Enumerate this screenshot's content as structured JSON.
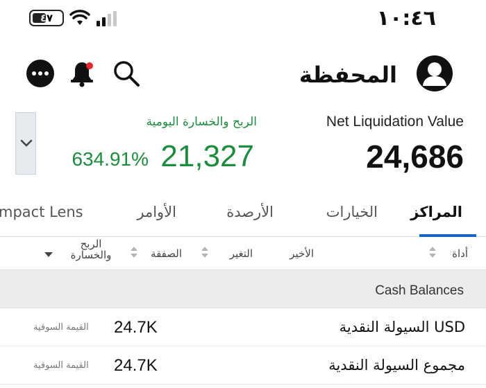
{
  "status_bar": {
    "time": "١٠:٤٦",
    "battery_text": "٤٧",
    "battery_level": 0.47
  },
  "header": {
    "title": "المحفظة",
    "notification_dot_color": "#e5262c",
    "icons": [
      "more-icon",
      "bell-icon",
      "search-icon",
      "user-avatar-icon"
    ]
  },
  "summary": {
    "net_liquidation_label": "Net Liquidation Value",
    "net_liquidation_value": "24,686",
    "daily_pnl_label": "الربح والخسارة اليومية",
    "daily_pnl_value": "21,327",
    "daily_pnl_percent": "634.91%",
    "positive_color": "#1e8c3e"
  },
  "tabs": [
    {
      "label": "المراكز",
      "active": true
    },
    {
      "label": "الخيارات",
      "active": false
    },
    {
      "label": "الأرصدة",
      "active": false
    },
    {
      "label": "الأوامر",
      "active": false
    },
    {
      "label": "mpact Lens",
      "active": false
    }
  ],
  "accent_color": "#1666c5",
  "columns": {
    "instrument": "أداة",
    "last": "الأخير",
    "change": "التغير",
    "trade": "الصفقة",
    "pnl": "الربح والخسارة"
  },
  "section": {
    "title": "Cash Balances",
    "rows": [
      {
        "name": "السيولة النقدية USD",
        "value": "24.7K",
        "note": "القيمة السوقية"
      },
      {
        "name": "مجموع السيولة النقدية",
        "value": "24.7K",
        "note": "القيمة السوقية"
      }
    ]
  }
}
